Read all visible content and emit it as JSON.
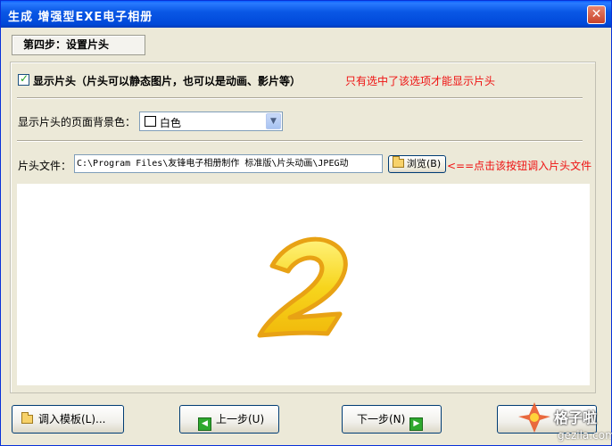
{
  "window": {
    "title": "生成 增强型EXE电子相册",
    "close_symbol": "✕"
  },
  "step": {
    "label": "第四步：设置片头"
  },
  "show_header": {
    "checked": true,
    "label": "显示片头（片头可以静态图片，也可以是动画、影片等）",
    "hint": "只有选中了该选项才能显示片头"
  },
  "background": {
    "label": "显示片头的页面背景色：",
    "selected": "白色",
    "swatch_color": "#ffffff"
  },
  "file": {
    "label": "片头文件：",
    "value": "C:\\Program Files\\友锋电子相册制作 标准版\\片头动画\\JPEG动",
    "browse_label": "浏览(B)",
    "hint": "<==点击该按钮调入片头文件"
  },
  "preview": {
    "digit": "2",
    "digit_color": "#f7d51d",
    "digit_outline": "#e8a214"
  },
  "buttons": {
    "template_label": "调入模板(L)...",
    "prev_label": "上一步(U)",
    "next_label": "下一步(N)",
    "finish_label": ""
  },
  "watermark": {
    "name": "格子啦",
    "url": "gezila.com"
  },
  "colors": {
    "title_bar": "#0a58e6",
    "hint_red": "#ee1111",
    "dialog_bg": "#ece9d8"
  }
}
